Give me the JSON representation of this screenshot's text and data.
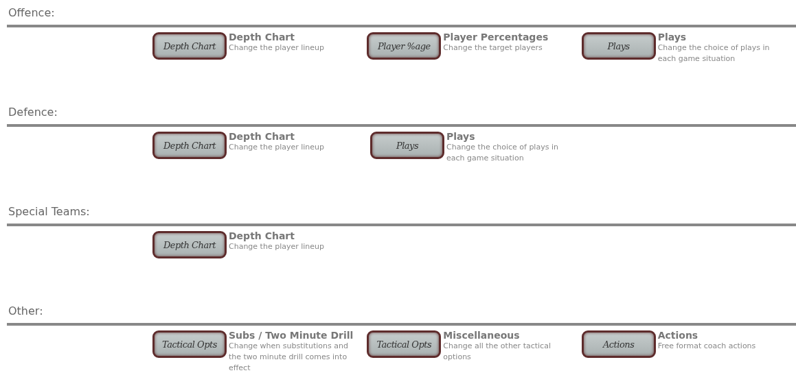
{
  "sections": [
    {
      "title": "Offence:",
      "items": [
        {
          "button": "Depth Chart",
          "title": "Depth Chart",
          "description": "Change the player lineup"
        },
        {
          "button": "Player %age",
          "title": "Player Percentages",
          "description": "Change the target players"
        },
        {
          "button": "Plays",
          "title": "Plays",
          "description": "Change the choice of plays in each game situation"
        }
      ]
    },
    {
      "title": "Defence:",
      "items": [
        {
          "button": "Depth Chart",
          "title": "Depth Chart",
          "description": "Change the player lineup"
        },
        {
          "button": "Plays",
          "title": "Plays",
          "description": "Change the choice of plays in each game situation"
        }
      ]
    },
    {
      "title": "Special Teams:",
      "items": [
        {
          "button": "Depth Chart",
          "title": "Depth Chart",
          "description": "Change the player lineup"
        }
      ]
    },
    {
      "title": "Other:",
      "items": [
        {
          "button": "Tactical Opts",
          "title": "Subs / Two Minute Drill",
          "description": "Change when substitutions and the two minute drill comes into effect"
        },
        {
          "button": "Tactical Opts",
          "title": "Miscellaneous",
          "description": "Change all the other tactical options"
        },
        {
          "button": "Actions",
          "title": "Actions",
          "description": "Free format coach actions"
        }
      ]
    }
  ]
}
